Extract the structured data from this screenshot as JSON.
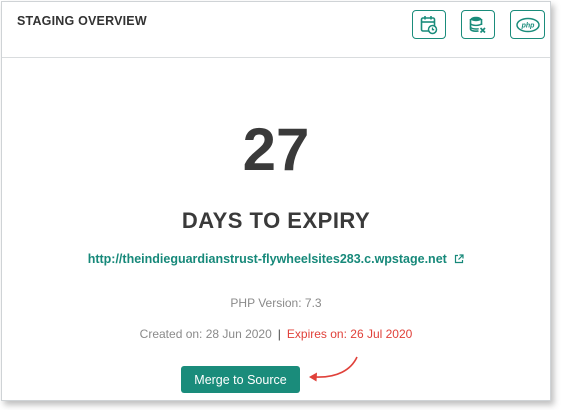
{
  "header": {
    "title": "STAGING OVERVIEW",
    "buttons": [
      {
        "icon": "calendar-clock-icon"
      },
      {
        "icon": "database-remove-icon"
      },
      {
        "icon": "php-icon",
        "label": "php"
      }
    ]
  },
  "expiry": {
    "days": "27",
    "label": "DAYS TO EXPIRY"
  },
  "site": {
    "url": "http://theindieguardianstrust-flywheelsites283.c.wpstage.net",
    "icon": "external-link-icon"
  },
  "php_version": "PHP Version: 7.3",
  "dates": {
    "created": "Created on: 28 Jun 2020",
    "separator": "|",
    "expires": "Expires on: 26 Jul 2020"
  },
  "actions": {
    "merge_label": "Merge to Source"
  },
  "colors": {
    "accent": "#1a8c7b",
    "link": "#17897a",
    "expires": "#e0413a",
    "annotation_arrow": "#e0413a"
  }
}
